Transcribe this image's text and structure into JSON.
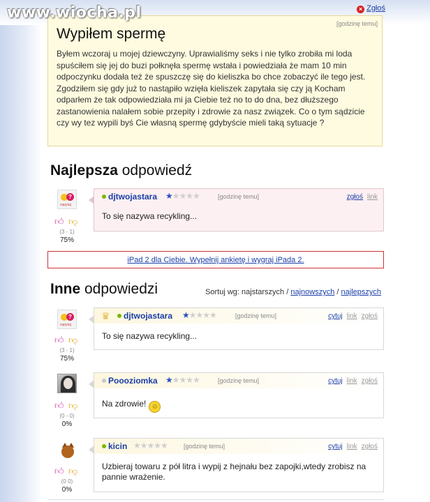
{
  "watermark": "www.wiocha.pl",
  "report_top": {
    "label": "Zgłoś"
  },
  "question": {
    "time": "[godzinę temu]",
    "title": "Wypiłem spermę",
    "body": "Byłem wczoraj u mojej dziewczyny. Uprawialiśmy seks i nie tylko zrobiła mi loda spuściłem się jej do buzi połknęła spermę wstała i powiedziała że mam 10 min odpoczynku dodała też że spuszczę się do kieliszka bo chce zobaczyć ile tego jest. Zgodziłem się gdy już to nastąpiło wzięła kieliszek zapytała się czy ją Kocham odparłem że tak odpowiedziała mi ja Ciebie też no to do dna, bez dłuższego zastanowienia nalałem sobie przepity i zdrowie za nasz związek. Co o tym sądzicie czy wy tez wypili byś Cie własną spermę gdybyście mieli taką sytuacje ?"
  },
  "best": {
    "title_bold": "Najlepsza",
    "title_rest": " odpowiedź",
    "answer": {
      "user": "djtwojastara",
      "time": "[godzinę temu]",
      "links": [
        "zgłoś",
        "link"
      ],
      "text": "To się nazywa recykling...",
      "rating_filled": 1,
      "votes": "(3 - 1)",
      "percent": "75%"
    }
  },
  "ad": {
    "text": "iPad 2 dla Ciebie. Wypełnij ankietę i wygraj iPada 2."
  },
  "others": {
    "title_bold": "Inne",
    "title_rest": " odpowiedzi",
    "sort": {
      "label": "Sortuj wg: najstarszych /",
      "opt1": "najnowszych",
      "sep": "/",
      "opt2": "najlepszych"
    },
    "answers": [
      {
        "user": "djtwojastara",
        "time": "[godzinę temu]",
        "links": [
          "cytuj",
          "link",
          "zgłoś"
        ],
        "text": "To się nazywa recykling...",
        "rating_filled": 1,
        "online": true,
        "crown": true,
        "votes": "(3 - 1)",
        "percent": "75%",
        "avatar": "logo"
      },
      {
        "user": "Poooziomka",
        "time": "[godzinę temu]",
        "links": [
          "cytuj",
          "link",
          "zgłoś"
        ],
        "text": "Na zdrowie!",
        "rating_filled": 1,
        "online": false,
        "crown": false,
        "votes": "(0 - 0)",
        "percent": "0%",
        "avatar": "photo",
        "smiley": true
      },
      {
        "user": "kicin",
        "time": "[godzinę temu]",
        "links": [
          "cytuj",
          "link",
          "zgłoś"
        ],
        "text": "Uzbieraj towaru z pół litra i wypij z hejnału bez zapojki,wtedy zrobisz na pannie wrażenie.",
        "rating_filled": 0,
        "online": true,
        "crown": false,
        "votes": "(0 0)",
        "percent": "0%",
        "avatar": "cat"
      }
    ]
  },
  "colors": {
    "link": "#1a3ea8",
    "online": "#7ab800",
    "star": "#2a4ebd",
    "question_bg": "#fffbe0"
  }
}
